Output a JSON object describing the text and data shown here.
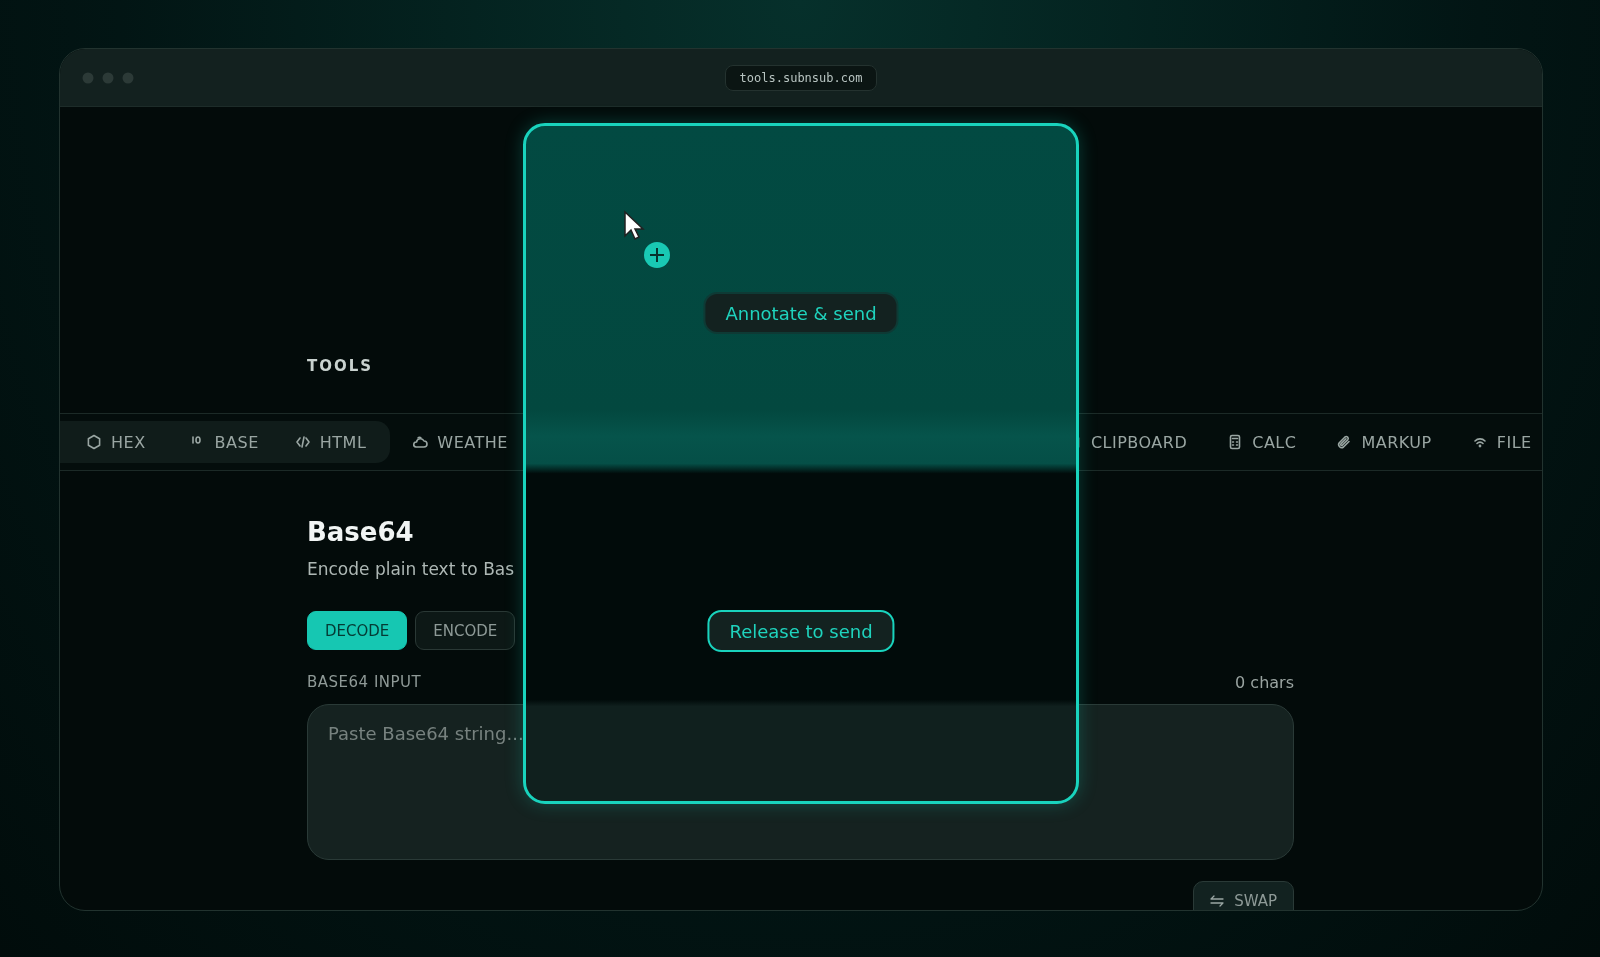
{
  "window": {
    "url": "tools.subnsub.com"
  },
  "section_label": "TOOLS",
  "tabs": [
    {
      "label": "HEX",
      "highlighted": true
    },
    {
      "label": "BASE",
      "highlighted": true
    },
    {
      "label": "HTML",
      "highlighted": true
    },
    {
      "label": "WEATHE",
      "highlighted": false
    },
    {
      "label": "CLIPBOARD",
      "highlighted": false
    },
    {
      "label": "CALC",
      "highlighted": false
    },
    {
      "label": "MARKUP",
      "highlighted": false
    },
    {
      "label": "FILE",
      "highlighted": false
    }
  ],
  "tool": {
    "title": "Base64",
    "description": "Encode plain text to Bas",
    "modes": [
      {
        "label": "DECODE",
        "selected": true
      },
      {
        "label": "ENCODE",
        "selected": false
      }
    ],
    "input_label": "BASE64 INPUT",
    "char_count": "0 chars",
    "placeholder": "Paste Base64 string...",
    "swap_button": "SWAP"
  },
  "drop_overlay": {
    "annotate_button": "Annotate & send",
    "release_button": "Release to send"
  }
}
